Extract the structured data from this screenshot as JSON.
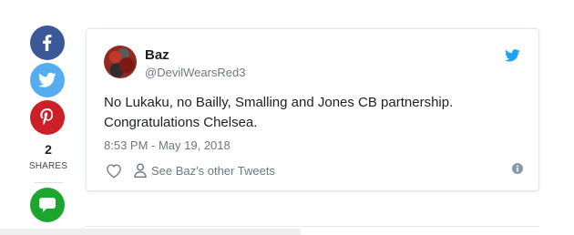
{
  "share": {
    "count": "2",
    "label": "SHARES",
    "buttons": [
      {
        "network": "facebook",
        "icon": "facebook-icon",
        "color": "#3b5998"
      },
      {
        "network": "twitter",
        "icon": "twitter-icon",
        "color": "#55acee"
      },
      {
        "network": "pinterest",
        "icon": "pinterest-icon",
        "color": "#cb2027"
      },
      {
        "network": "sms",
        "icon": "message-icon",
        "color": "#1ca52f"
      }
    ]
  },
  "tweet": {
    "author_name": "Baz",
    "author_handle": "@DevilWearsRed3",
    "text_line1": "No Lukaku, no Bailly, Smalling and Jones CB partnership.",
    "text_line2": "Congratulations Chelsea.",
    "timestamp": "8:53 PM - May 19, 2018",
    "other_tweets_label": "See Baz's other Tweets",
    "twitter_color": "#1da1f2"
  }
}
